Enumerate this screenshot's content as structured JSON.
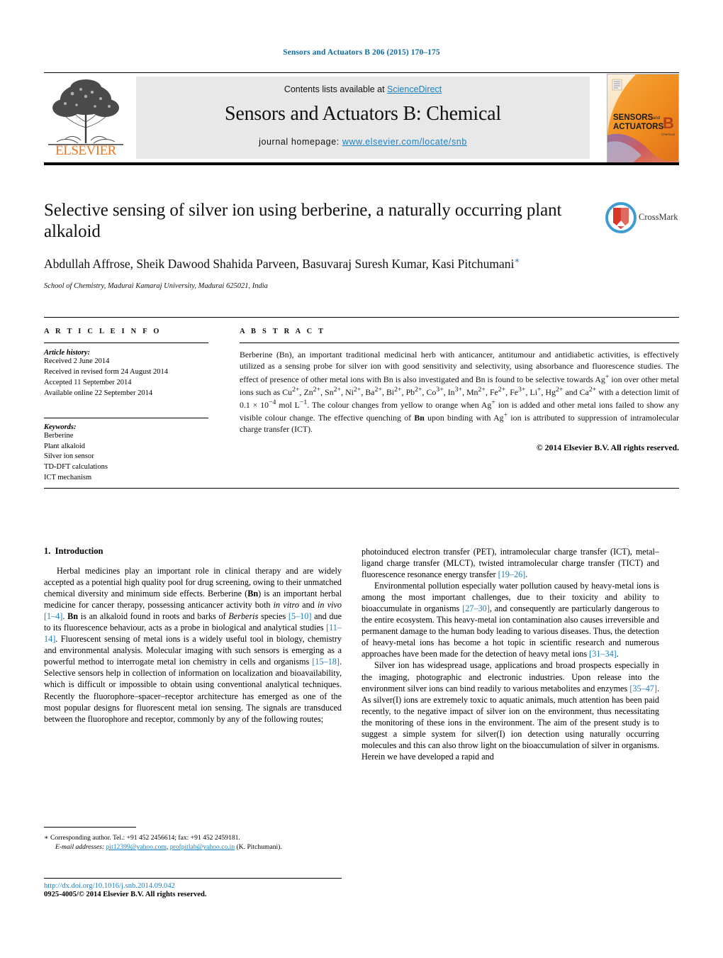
{
  "running_head": "Sensors and Actuators B 206 (2015) 170–175",
  "masthead": {
    "contents_prefix": "Contents lists available at ",
    "sciencedirect": "ScienceDirect",
    "journal_title": "Sensors and Actuators B: Chemical",
    "homepage_prefix": "journal homepage: ",
    "homepage_url": "www.elsevier.com/locate/snb",
    "publisher_wordmark": "ELSEVIER",
    "cover_line1": "SENSORS",
    "cover_and": "and",
    "cover_line2": "ACTUATORS",
    "cover_letter": "B",
    "cover_sub": "Chemical",
    "link_color": "#1a7fc1",
    "band_color": "#e8e8e8",
    "elsevier_orange": "#e87722"
  },
  "title_block": {
    "title": "Selective sensing of silver ion using berberine, a naturally occurring plant alkaloid",
    "authors": "Abdullah Affrose, Sheik Dawood Shahida Parveen, Basuvaraj Suresh Kumar, Kasi Pitchumani",
    "corresponding_marker": "∗",
    "affiliation": "School of Chemistry, Madurai Kamaraj University, Madurai 625021, India",
    "crossmark_label": "CrossMark"
  },
  "article_info": {
    "heading": "A R T I C L E   I N F O",
    "history_label": "Article history:",
    "history": [
      "Received 2 June 2014",
      "Received in revised form 24 August 2014",
      "Accepted 11 September 2014",
      "Available online 22 September 2014"
    ],
    "keywords_label": "Keywords:",
    "keywords": [
      "Berberine",
      "Plant alkaloid",
      "Silver ion sensor",
      "TD-DFT calculations",
      "ICT mechanism"
    ]
  },
  "abstract": {
    "heading": "A B S T R A C T",
    "text_p1": "Berberine (Bn), an important traditional medicinal herb with anticancer, antitumour and antidiabetic activities, is effectively utilized as a sensing probe for silver ion with good sensitivity and selectivity, using absorbance and fluorescence studies. The effect of presence of other metal ions with Bn is also investigated and Bn is found to be selective towards Ag",
    "text_p2": " ion over other metal ions such as Cu",
    "metal_ions": "Cu2+, Zn2+, Sn2+, Ni2+, Ba2+, Bi2+, Pb2+, Co3+, In3+, Mn2+, Fe2+, Fe3+, Li+, Hg2+ and Ca2+",
    "detection_limit": "0.1 × 10−4 mol L−1",
    "text_tail": "The colour changes from yellow to orange when Ag+ ion is added and other metal ions failed to show any visible colour change. The effective quenching of Bn upon binding with Ag+ ion is attributed to suppression of intramolecular charge transfer (ICT).",
    "copyright": "© 2014 Elsevier B.V. All rights reserved."
  },
  "introduction": {
    "section_number": "1.",
    "section_title": "Introduction",
    "left_paragraphs": [
      "Herbal medicines play an important role in clinical therapy and are widely accepted as a potential high quality pool for drug screening, owing to their unmatched chemical diversity and minimum side effects. Berberine (Bn) is an important herbal medicine for cancer therapy, possessing anticancer activity both in vitro and in vivo [1–4]. Bn is an alkaloid found in roots and barks of Berberis species [5–10] and due to its fluorescence behaviour, acts as a probe in biological and analytical studies [11–14]. Fluorescent sensing of metal ions is a widely useful tool in biology, chemistry and environmental analysis. Molecular imaging with such sensors is emerging as a powerful method to interrogate metal ion chemistry in cells and organisms [15–18]. Selective sensors help in collection of information on localization and bioavailability, which is difficult or impossible to obtain using conventional analytical techniques. Recently the fluorophore–spacer–receptor architecture has emerged as one of the most popular designs for fluorescent metal ion sensing. The signals are transduced between the fluorophore and receptor, commonly by any of the following routes;"
    ],
    "right_paragraphs": [
      "photoinduced electron transfer (PET), intramolecular charge transfer (ICT), metal–ligand charge transfer (MLCT), twisted intramolecular charge transfer (TICT) and fluorescence resonance energy transfer [19–26].",
      "Environmental pollution especially water pollution caused by heavy-metal ions is among the most important challenges, due to their toxicity and ability to bioaccumulate in organisms [27–30], and consequently are particularly dangerous to the entire ecosystem. This heavy-metal ion contamination also causes irreversible and permanent damage to the human body leading to various diseases. Thus, the detection of heavy-metal ions has become a hot topic in scientific research and numerous approaches have been made for the detection of heavy metal ions [31–34].",
      "Silver ion has widespread usage, applications and broad prospects especially in the imaging, photographic and electronic industries. Upon release into the environment silver ions can bind readily to various metabolites and enzymes [35–47]. As silver(I) ions are extremely toxic to aquatic animals, much attention has been paid recently, to the negative impact of silver ion on the environment, thus necessitating the monitoring of these ions in the environment. The aim of the present study is to suggest a simple system for silver(I) ion detection using naturally occurring molecules and this can also throw light on the bioaccumulation of silver in organisms. Herein we have developed a rapid and"
    ]
  },
  "footnote": {
    "marker": "∗",
    "corresponding": "Corresponding author. Tel.: +91 452 2456614; fax: +91 452 2459181.",
    "email_label": "E-mail addresses:",
    "email1": "pit12399@yahoo.com",
    "email_sep": ", ",
    "email2": "profpitlab@yahoo.co.in",
    "email_suffix": " (K. Pitchumani)."
  },
  "doi_block": {
    "doi_url": "http://dx.doi.org/10.1016/j.snb.2014.09.042",
    "issn_line": "0925-4005/© 2014 Elsevier B.V. All rights reserved."
  }
}
